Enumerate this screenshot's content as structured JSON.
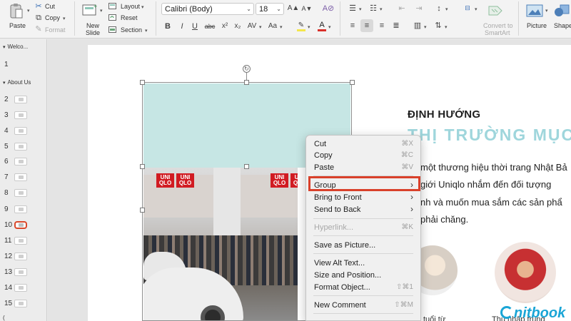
{
  "ribbon": {
    "paste": "Paste",
    "cut": "Cut",
    "copy": "Copy",
    "format": "Format",
    "new_slide_line1": "New",
    "new_slide_line2": "Slide",
    "layout": "Layout",
    "reset": "Reset",
    "section": "Section",
    "font_name": "Calibri (Body)",
    "font_size": "18",
    "bold": "B",
    "italic": "I",
    "underline": "U",
    "strikethrough": "abc",
    "superscript": "x²",
    "subscript": "x₂",
    "char_spacing": "AV",
    "change_case": "Aa",
    "font_grow": "A▲",
    "font_shrink": "A▼",
    "clear_format": "A⊘",
    "convert_smartart_line1": "Convert to",
    "convert_smartart_line2": "SmartArt",
    "picture": "Picture",
    "shapes": "Shapes",
    "colors": {
      "accent": "#d9402a",
      "highlight": "#f4e64b",
      "font_color": "#d9302a"
    }
  },
  "thumbnails": {
    "sections": [
      {
        "title": "Welco..."
      },
      {
        "title": "About Us"
      }
    ],
    "slides": [
      "1",
      "2",
      "3",
      "4",
      "5",
      "6",
      "7",
      "8",
      "9",
      "10",
      "11",
      "12",
      "13",
      "14",
      "15"
    ],
    "selected_slide": "10",
    "bottom_fragment": "("
  },
  "slide": {
    "heading1": "ĐỊNH HƯỚNG",
    "heading2": "THỊ TRƯỜNG MỤC TI",
    "para_lines": [
      "một thương hiệu thời trang Nhật Bả",
      "giới Uniqlo nhắm đến đối tượng",
      "nh và muốn mua sắm các sản phẩ",
      "phải chăng."
    ],
    "store_signs": [
      "UNI QLO",
      "UNI QLO",
      "UNI QLO",
      "UNI QLO"
    ],
    "caption1": "tuổi từ",
    "caption2": "Thu nhập trung",
    "logo_text": "nitbook",
    "colors": {
      "teal_block": "#c6e6e4",
      "heading2": "#9fd6dc",
      "logo": "#1aa5d6"
    }
  },
  "context_menu": {
    "items": [
      {
        "label": "Cut",
        "shortcut": "⌘X",
        "disabled": false
      },
      {
        "label": "Copy",
        "shortcut": "⌘C",
        "disabled": false
      },
      {
        "label": "Paste",
        "shortcut": "⌘V",
        "disabled": false
      },
      {
        "label": "Group",
        "submenu": true,
        "highlighted": true
      },
      {
        "label": "Bring to Front",
        "submenu": true
      },
      {
        "label": "Send to Back",
        "submenu": true
      },
      {
        "label": "Hyperlink...",
        "shortcut": "⌘K",
        "disabled": true
      },
      {
        "label": "Save as Picture..."
      },
      {
        "label": "View Alt Text..."
      },
      {
        "label": "Size and Position..."
      },
      {
        "label": "Format Object...",
        "shortcut": "⇧⌘1"
      },
      {
        "label": "New Comment",
        "shortcut": "⇧⌘M"
      }
    ]
  }
}
